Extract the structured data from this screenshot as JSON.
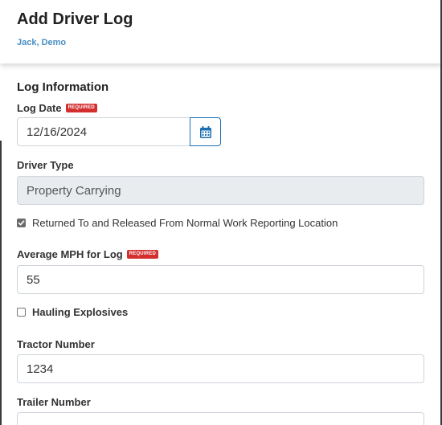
{
  "header": {
    "title": "Add Driver Log",
    "subtitle": "Jack, Demo"
  },
  "section": {
    "title": "Log Information"
  },
  "fields": {
    "log_date": {
      "label": "Log Date",
      "badge": "REQUIRED",
      "value": "12/16/2024"
    },
    "driver_type": {
      "label": "Driver Type",
      "value": "Property Carrying"
    },
    "returned": {
      "label": "Returned To and Released From Normal Work Reporting Location",
      "checked": true
    },
    "avg_mph": {
      "label": "Average MPH for Log",
      "badge": "REQUIRED",
      "value": "55"
    },
    "hauling": {
      "label": "Hauling Explosives",
      "checked": false
    },
    "tractor": {
      "label": "Tractor Number",
      "value": "1234"
    },
    "trailer": {
      "label": "Trailer Number",
      "value": ""
    }
  },
  "icons": {
    "calendar": "calendar-icon",
    "check": "check-icon"
  },
  "colors": {
    "accent": "#1a6fb5",
    "badge": "#d32f2f",
    "subtitle": "#4a8fc4",
    "disabled": "#e9ecef"
  }
}
